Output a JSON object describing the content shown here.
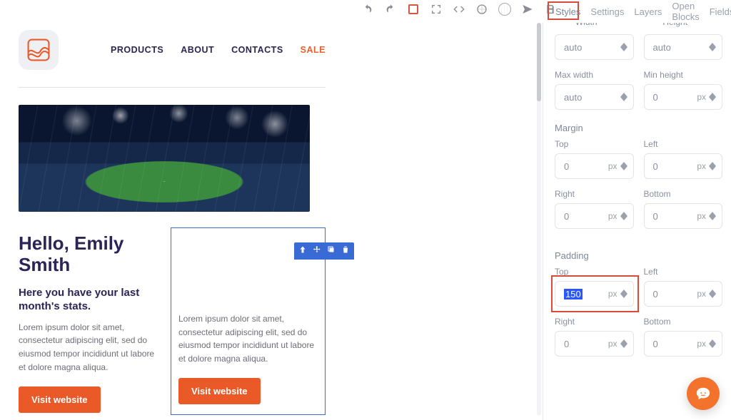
{
  "tabs": {
    "styles": "Styles",
    "settings": "Settings",
    "layers": "Layers",
    "open_blocks": "Open Blocks",
    "fields": "Fields"
  },
  "panel": {
    "width_label_cut": "Width",
    "height_label_cut": "Height",
    "auto": "auto",
    "max_width": "Max width",
    "min_height": "Min height",
    "min_height_val": "0",
    "margin": "Margin",
    "padding": "Padding",
    "top": "Top",
    "left": "Left",
    "right": "Right",
    "bottom": "Bottom",
    "zero": "0",
    "unit_px": "px",
    "padding_top_val": "150"
  },
  "email": {
    "nav": {
      "products": "PRODUCTS",
      "about": "ABOUT",
      "contacts": "CONTACTS",
      "sale": "SALE"
    },
    "greeting": "Hello, Emily Smith",
    "subhead": "Here you have your last month's stats.",
    "lorem": "Lorem ipsum dolor sit amet, consectetur adipiscing elit, sed do eiusmod tempor incididunt ut labore et dolore magna aliqua.",
    "cta": "Visit website"
  }
}
